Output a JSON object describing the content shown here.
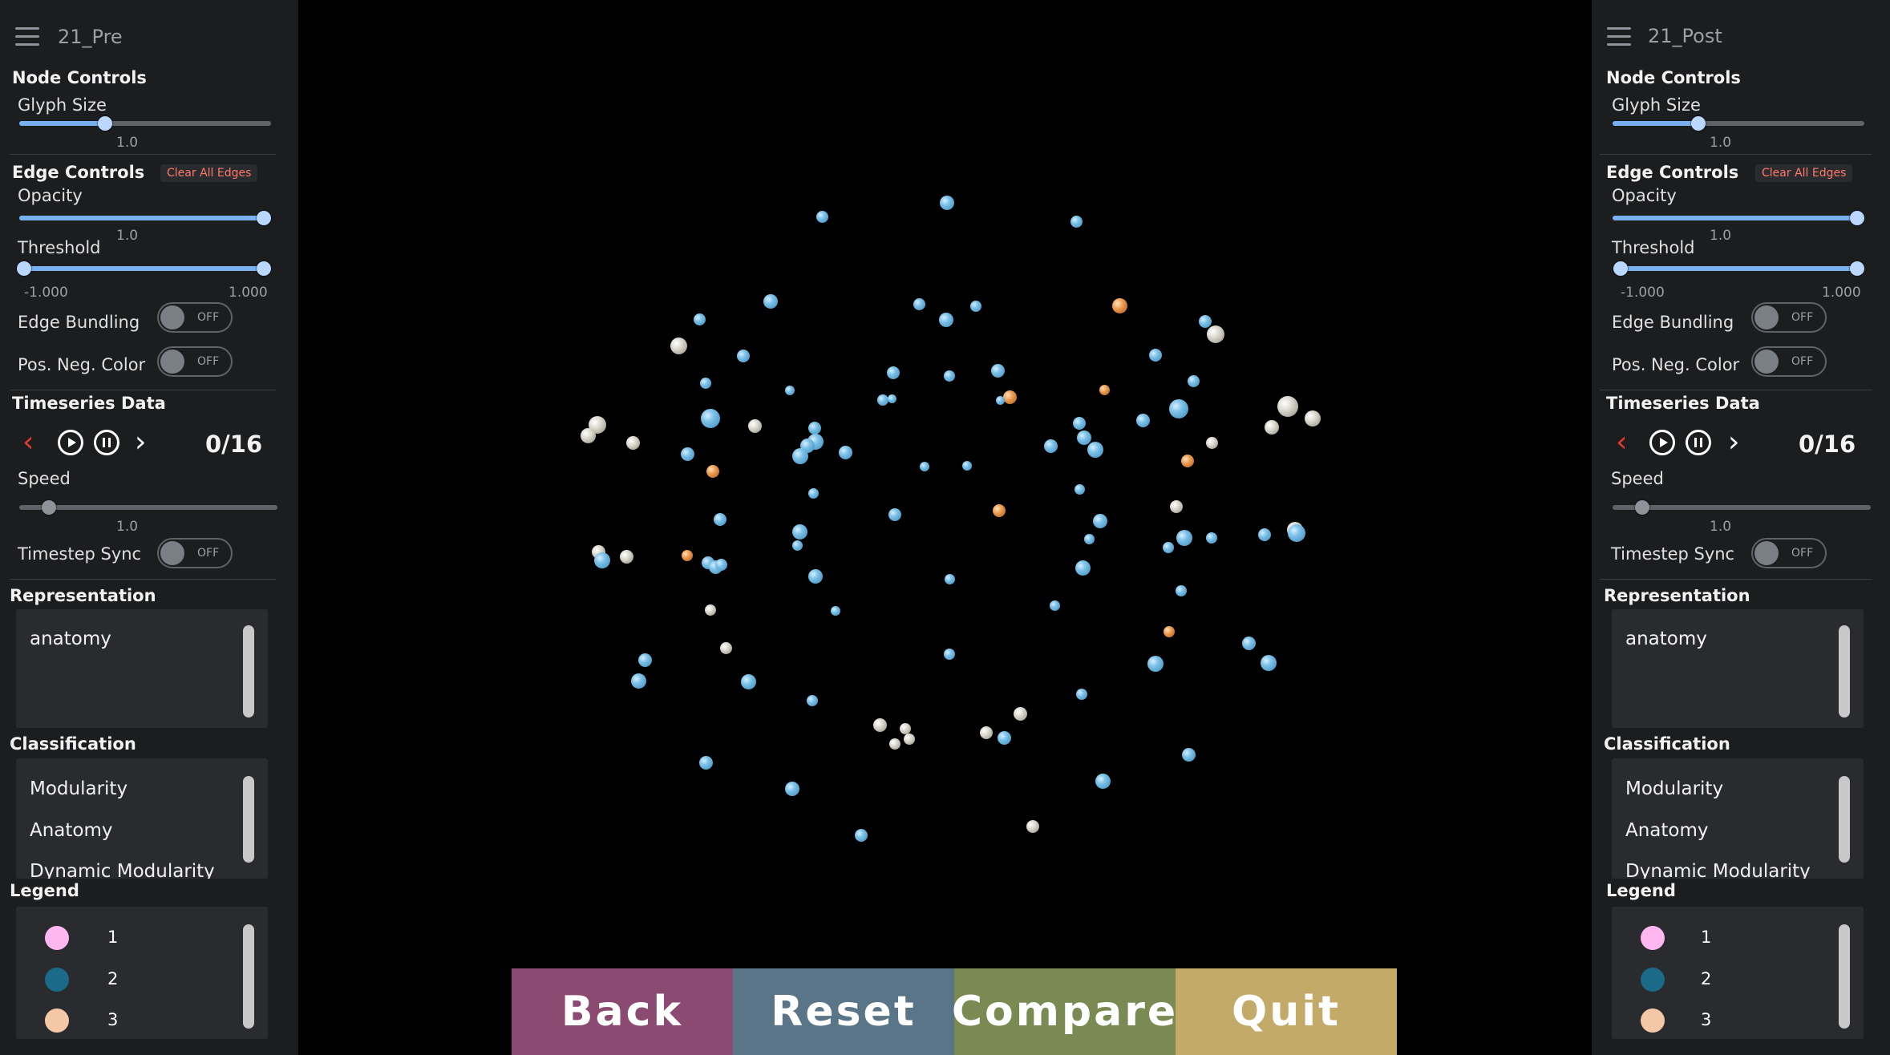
{
  "left_panel": {
    "title": "21_Pre",
    "node_controls": {
      "heading": "Node Controls",
      "glyph_size_label": "Glyph Size",
      "glyph_size_value": "1.0",
      "glyph_size_level": 0.34
    },
    "edge_controls": {
      "heading": "Edge Controls",
      "clear_label": "Clear All Edges",
      "opacity_label": "Opacity",
      "opacity_value": "1.0",
      "opacity_level": 1.0,
      "threshold_label": "Threshold",
      "threshold_min": "-1.000",
      "threshold_max": "1.000",
      "edge_bundling_label": "Edge Bundling",
      "pos_neg_label": "Pos. Neg. Color",
      "toggle_state": "OFF"
    },
    "timeseries": {
      "heading": "Timeseries Data",
      "counter": "0/16",
      "speed_label": "Speed",
      "speed_value": "1.0",
      "speed_level": 0.12,
      "timestep_sync_label": "Timestep Sync",
      "toggle_state": "OFF"
    },
    "representation": {
      "heading": "Representation",
      "selected": "anatomy"
    },
    "classification": {
      "heading": "Classification",
      "items": [
        "Modularity",
        "Anatomy",
        "Dynamic Modularity"
      ]
    },
    "legend": {
      "heading": "Legend",
      "items": [
        {
          "label": "1",
          "color": "#ffb7f2"
        },
        {
          "label": "2",
          "color": "#1b6a8a"
        },
        {
          "label": "3",
          "color": "#f4c8a6"
        }
      ]
    }
  },
  "right_panel": {
    "title": "21_Post",
    "node_controls": {
      "heading": "Node Controls",
      "glyph_size_label": "Glyph Size",
      "glyph_size_value": "1.0",
      "glyph_size_level": 0.34
    },
    "edge_controls": {
      "heading": "Edge Controls",
      "clear_label": "Clear All Edges",
      "opacity_label": "Opacity",
      "opacity_value": "1.0",
      "opacity_level": 1.0,
      "threshold_label": "Threshold",
      "threshold_min": "-1.000",
      "threshold_max": "1.000",
      "edge_bundling_label": "Edge Bundling",
      "pos_neg_label": "Pos. Neg. Color",
      "toggle_state": "OFF"
    },
    "timeseries": {
      "heading": "Timeseries Data",
      "counter": "0/16",
      "speed_label": "Speed",
      "speed_value": "1.0",
      "speed_level": 0.12,
      "timestep_sync_label": "Timestep Sync",
      "toggle_state": "OFF"
    },
    "representation": {
      "heading": "Representation",
      "selected": "anatomy"
    },
    "classification": {
      "heading": "Classification",
      "items": [
        "Modularity",
        "Anatomy",
        "Dynamic Modularity"
      ]
    },
    "legend": {
      "heading": "Legend",
      "items": [
        {
          "label": "1",
          "color": "#ffb7f2"
        },
        {
          "label": "2",
          "color": "#1b6a8a"
        },
        {
          "label": "3",
          "color": "#f4c8a6"
        }
      ]
    }
  },
  "bottom_buttons": {
    "back": {
      "label": "Back",
      "color": "#8a4a72"
    },
    "reset": {
      "label": "Reset",
      "color": "#5a7588"
    },
    "compare": {
      "label": "Compare",
      "color": "#7a8a52"
    },
    "quit": {
      "label": "Quit",
      "color": "#c4aa68"
    }
  },
  "viewport": {
    "node_colors": {
      "blue": "#7cc1e8",
      "orange": "#ec9a50",
      "gray": "#d8d6cb"
    }
  }
}
